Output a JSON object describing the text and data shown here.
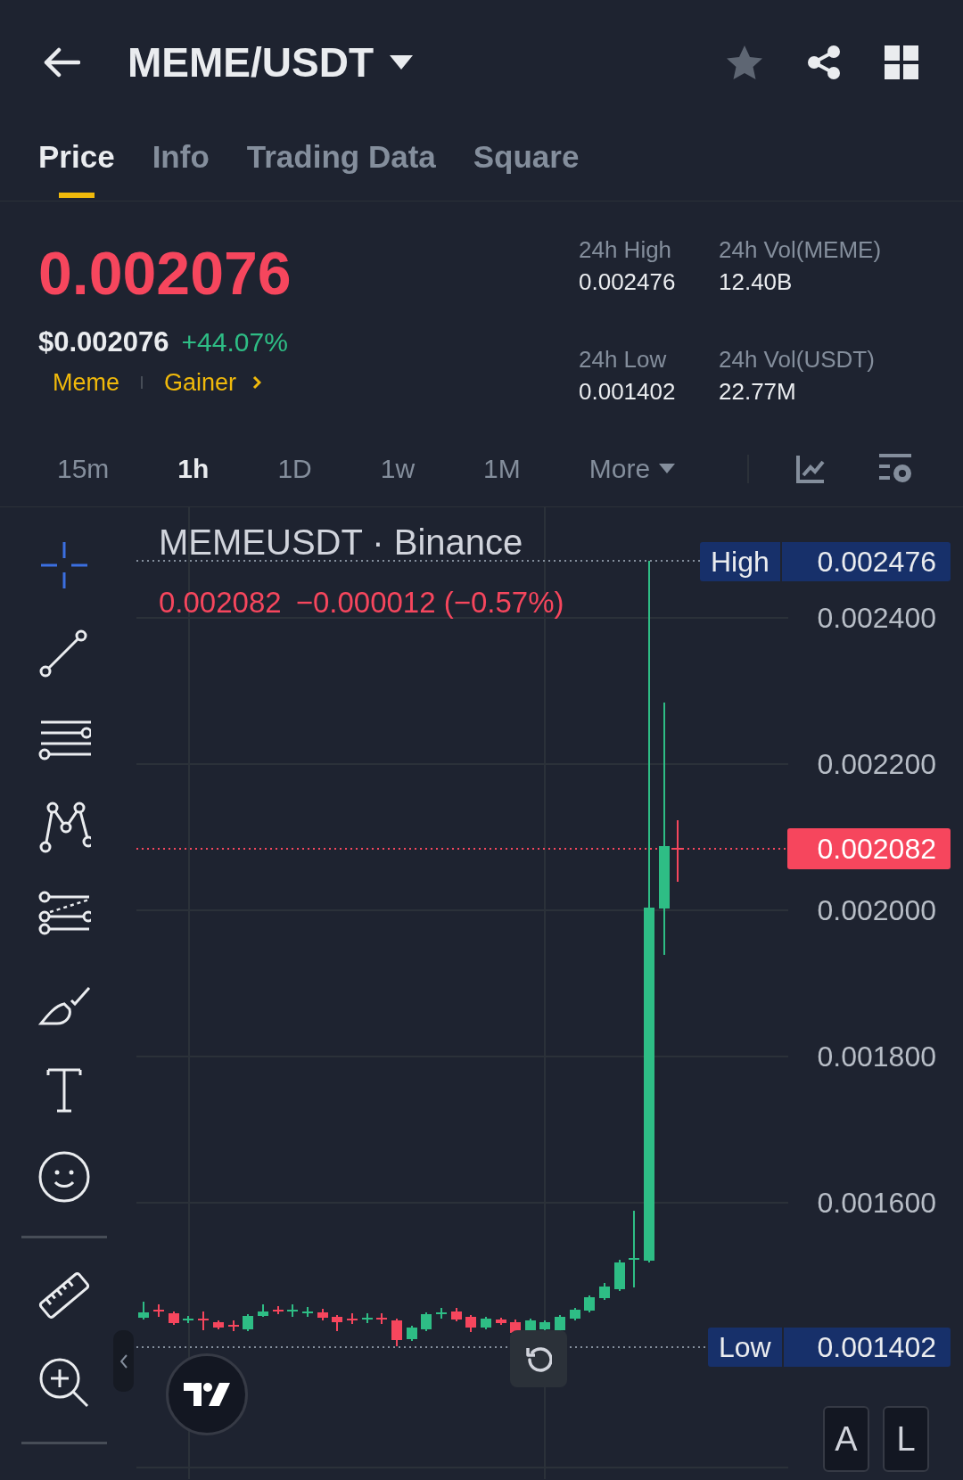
{
  "header": {
    "title": "MEME/USDT",
    "favorite": false
  },
  "tabs": [
    {
      "label": "Price",
      "selected": true
    },
    {
      "label": "Info",
      "selected": false
    },
    {
      "label": "Trading Data",
      "selected": false
    },
    {
      "label": "Square",
      "selected": false
    }
  ],
  "price": {
    "last": "0.002076",
    "usd": "$0.002076",
    "change": "+44.07%",
    "tags": [
      "Meme",
      "Gainer"
    ]
  },
  "stats": [
    {
      "label": "24h High",
      "value": "0.002476"
    },
    {
      "label": "24h Vol(MEME)",
      "value": "12.40B"
    },
    {
      "label": "24h Low",
      "value": "0.001402"
    },
    {
      "label": "24h Vol(USDT)",
      "value": "22.77M"
    }
  ],
  "intervals": [
    {
      "label": "15m",
      "selected": false
    },
    {
      "label": "1h",
      "selected": true
    },
    {
      "label": "1D",
      "selected": false
    },
    {
      "label": "1w",
      "selected": false
    },
    {
      "label": "1M",
      "selected": false
    }
  ],
  "more": "More",
  "chart": {
    "legend": "MEMEUSDT · Binance",
    "last": "0.002082",
    "change": "−0.000012 (−0.57%)",
    "price_axis": [
      "0.002400",
      "0.002200",
      "0.002000",
      "0.001800",
      "0.001600"
    ],
    "high": {
      "label": "High",
      "value": "0.002476"
    },
    "low": {
      "label": "Low",
      "value": "0.001402"
    },
    "current": "0.002082",
    "tools": [
      {
        "kind": "crosshair",
        "selected": true
      },
      {
        "kind": "trend-line",
        "selected": false
      },
      {
        "kind": "horizontal-lines",
        "selected": false
      },
      {
        "kind": "pattern",
        "selected": false
      },
      {
        "kind": "channel",
        "selected": false
      },
      {
        "kind": "brush",
        "selected": false
      },
      {
        "kind": "text",
        "selected": false
      },
      {
        "kind": "emoji",
        "selected": false
      },
      {
        "kind": "ruler",
        "selected": false
      },
      {
        "kind": "zoom-in",
        "selected": false
      }
    ],
    "scale_buttons": [
      "A",
      "L"
    ]
  }
}
